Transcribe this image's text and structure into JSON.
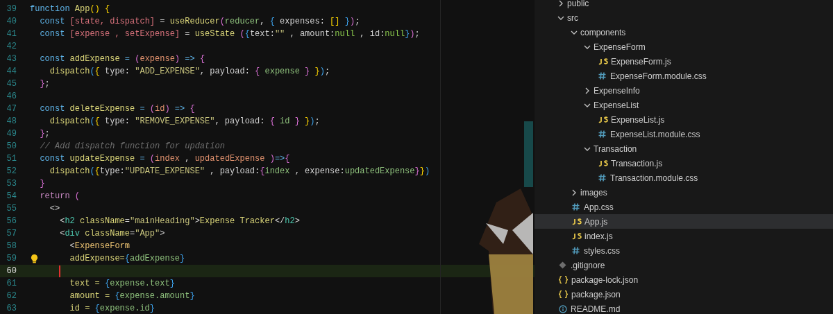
{
  "editor": {
    "lines": [
      {
        "number": "39",
        "current": false,
        "lightbulb": false,
        "tokens": [
          {
            "kind": "kw",
            "text": "function "
          },
          {
            "kind": "fn",
            "text": "App"
          },
          {
            "kind": "b1",
            "text": "() {"
          }
        ]
      },
      {
        "number": "40",
        "current": false,
        "lightbulb": false,
        "tokens": [
          {
            "kind": "kw",
            "text": "  const "
          },
          {
            "kind": "var",
            "text": "[state, dispatch]"
          },
          {
            "kind": "p",
            "text": " = "
          },
          {
            "kind": "fn",
            "text": "useReducer"
          },
          {
            "kind": "b2",
            "text": "("
          },
          {
            "kind": "ref",
            "text": "reducer"
          },
          {
            "kind": "p",
            "text": ", "
          },
          {
            "kind": "b3",
            "text": "{"
          },
          {
            "kind": "p",
            "text": " expenses: "
          },
          {
            "kind": "b1",
            "text": "[]"
          },
          {
            "kind": "b3",
            "text": " }"
          },
          {
            "kind": "b2",
            "text": ")"
          },
          {
            "kind": "p",
            "text": ";"
          }
        ]
      },
      {
        "number": "41",
        "current": false,
        "lightbulb": false,
        "tokens": [
          {
            "kind": "kw",
            "text": "  const "
          },
          {
            "kind": "var",
            "text": "[expense , setExpense]"
          },
          {
            "kind": "p",
            "text": " = "
          },
          {
            "kind": "fn",
            "text": "useState "
          },
          {
            "kind": "b2",
            "text": "("
          },
          {
            "kind": "b3",
            "text": "{"
          },
          {
            "kind": "p",
            "text": "text:"
          },
          {
            "kind": "str",
            "text": "\"\""
          },
          {
            "kind": "p",
            "text": " , amount:"
          },
          {
            "kind": "nul",
            "text": "null"
          },
          {
            "kind": "p",
            "text": " , id:"
          },
          {
            "kind": "nul",
            "text": "null"
          },
          {
            "kind": "b3",
            "text": "}"
          },
          {
            "kind": "b2",
            "text": ")"
          },
          {
            "kind": "p",
            "text": ";"
          }
        ]
      },
      {
        "number": "42",
        "current": false,
        "lightbulb": false
      },
      {
        "number": "43",
        "current": false,
        "lightbulb": false,
        "tokens": [
          {
            "kind": "kw",
            "text": "  const "
          },
          {
            "kind": "fn",
            "text": "addExpense"
          },
          {
            "kind": "kw",
            "text": " = "
          },
          {
            "kind": "b2",
            "text": "("
          },
          {
            "kind": "param",
            "text": "expense"
          },
          {
            "kind": "b2",
            "text": ")"
          },
          {
            "kind": "kw",
            "text": " => "
          },
          {
            "kind": "b2",
            "text": "{"
          }
        ]
      },
      {
        "number": "44",
        "current": false,
        "lightbulb": false,
        "tokens": [
          {
            "kind": "fn",
            "text": "    dispatch"
          },
          {
            "kind": "b3",
            "text": "("
          },
          {
            "kind": "b1",
            "text": "{"
          },
          {
            "kind": "p",
            "text": " type: "
          },
          {
            "kind": "str",
            "text": "\"ADD_EXPENSE\""
          },
          {
            "kind": "p",
            "text": ", payload: "
          },
          {
            "kind": "b2",
            "text": "{"
          },
          {
            "kind": "ref",
            "text": " expense "
          },
          {
            "kind": "b2",
            "text": "}"
          },
          {
            "kind": "b1",
            "text": " }"
          },
          {
            "kind": "b3",
            "text": ")"
          },
          {
            "kind": "p",
            "text": ";"
          }
        ]
      },
      {
        "number": "45",
        "current": false,
        "lightbulb": false,
        "tokens": [
          {
            "kind": "b2",
            "text": "  }"
          },
          {
            "kind": "p",
            "text": ";"
          }
        ]
      },
      {
        "number": "46",
        "current": false,
        "lightbulb": false
      },
      {
        "number": "47",
        "current": false,
        "lightbulb": false,
        "tokens": [
          {
            "kind": "kw",
            "text": "  const "
          },
          {
            "kind": "fn",
            "text": "deleteExpense"
          },
          {
            "kind": "kw",
            "text": " = "
          },
          {
            "kind": "b2",
            "text": "("
          },
          {
            "kind": "param",
            "text": "id"
          },
          {
            "kind": "b2",
            "text": ")"
          },
          {
            "kind": "kw",
            "text": " => "
          },
          {
            "kind": "b2",
            "text": "{"
          }
        ]
      },
      {
        "number": "48",
        "current": false,
        "lightbulb": false,
        "tokens": [
          {
            "kind": "fn",
            "text": "    dispatch"
          },
          {
            "kind": "b3",
            "text": "("
          },
          {
            "kind": "b1",
            "text": "{"
          },
          {
            "kind": "p",
            "text": " type: "
          },
          {
            "kind": "str",
            "text": "\"REMOVE_EXPENSE\""
          },
          {
            "kind": "p",
            "text": ", payload: "
          },
          {
            "kind": "b2",
            "text": "{"
          },
          {
            "kind": "ref",
            "text": " id "
          },
          {
            "kind": "b2",
            "text": "}"
          },
          {
            "kind": "b1",
            "text": " }"
          },
          {
            "kind": "b3",
            "text": ")"
          },
          {
            "kind": "p",
            "text": ";"
          }
        ]
      },
      {
        "number": "49",
        "current": false,
        "lightbulb": false,
        "tokens": [
          {
            "kind": "b2",
            "text": "  }"
          },
          {
            "kind": "p",
            "text": ";"
          }
        ]
      },
      {
        "number": "50",
        "current": false,
        "lightbulb": false,
        "tokens": [
          {
            "kind": "cmt",
            "text": "  // Add dispatch function for updation"
          }
        ]
      },
      {
        "number": "51",
        "current": false,
        "lightbulb": false,
        "tokens": [
          {
            "kind": "kw",
            "text": "  const "
          },
          {
            "kind": "fn",
            "text": "updateExpense"
          },
          {
            "kind": "kw",
            "text": " = "
          },
          {
            "kind": "b2",
            "text": "("
          },
          {
            "kind": "param",
            "text": "index"
          },
          {
            "kind": "p",
            "text": " , "
          },
          {
            "kind": "param",
            "text": "updatedExpense"
          },
          {
            "kind": "b2",
            "text": " )"
          },
          {
            "kind": "kw",
            "text": "=>"
          },
          {
            "kind": "b2",
            "text": "{"
          }
        ]
      },
      {
        "number": "52",
        "current": false,
        "lightbulb": false,
        "tokens": [
          {
            "kind": "fn",
            "text": "    dispatch"
          },
          {
            "kind": "b3",
            "text": "("
          },
          {
            "kind": "b1",
            "text": "{"
          },
          {
            "kind": "p",
            "text": "type:"
          },
          {
            "kind": "str",
            "text": "\"UPDATE_EXPENSE\""
          },
          {
            "kind": "p",
            "text": " , payload:"
          },
          {
            "kind": "b2",
            "text": "{"
          },
          {
            "kind": "ref",
            "text": "index"
          },
          {
            "kind": "p",
            "text": " , expense:"
          },
          {
            "kind": "ref",
            "text": "updatedExpense"
          },
          {
            "kind": "b2",
            "text": "}"
          },
          {
            "kind": "b1",
            "text": "}"
          },
          {
            "kind": "b3",
            "text": ")"
          }
        ]
      },
      {
        "number": "53",
        "current": false,
        "lightbulb": false,
        "tokens": [
          {
            "kind": "b2",
            "text": "  }"
          }
        ]
      },
      {
        "number": "54",
        "current": false,
        "lightbulb": false,
        "tokens": [
          {
            "kind": "ctl",
            "text": "  return "
          },
          {
            "kind": "b2",
            "text": "("
          }
        ]
      },
      {
        "number": "55",
        "current": false,
        "lightbulb": false,
        "tokens": [
          {
            "kind": "p",
            "text": "    <>"
          }
        ]
      },
      {
        "number": "56",
        "current": false,
        "lightbulb": false,
        "tokens": [
          {
            "kind": "p",
            "text": "      <"
          },
          {
            "kind": "tag",
            "text": "h2"
          },
          {
            "kind": "attr",
            "text": " className"
          },
          {
            "kind": "p",
            "text": "="
          },
          {
            "kind": "str",
            "text": "\"mainHeading\""
          },
          {
            "kind": "p",
            "text": ">"
          },
          {
            "kind": "attr",
            "text": "Expense Tracker"
          },
          {
            "kind": "p",
            "text": "</"
          },
          {
            "kind": "tag",
            "text": "h2"
          },
          {
            "kind": "p",
            "text": ">"
          }
        ]
      },
      {
        "number": "57",
        "current": false,
        "lightbulb": false,
        "tokens": [
          {
            "kind": "p",
            "text": "      <"
          },
          {
            "kind": "tag",
            "text": "div"
          },
          {
            "kind": "attr",
            "text": " className"
          },
          {
            "kind": "p",
            "text": "="
          },
          {
            "kind": "str",
            "text": "\"App\""
          },
          {
            "kind": "p",
            "text": ">"
          }
        ]
      },
      {
        "number": "58",
        "current": false,
        "lightbulb": false,
        "tokens": [
          {
            "kind": "p",
            "text": "        <"
          },
          {
            "kind": "comp",
            "text": "ExpenseForm"
          }
        ]
      },
      {
        "number": "59",
        "current": false,
        "lightbulb": true,
        "tokens": [
          {
            "kind": "attr",
            "text": "        addExpense="
          },
          {
            "kind": "b3",
            "text": "{"
          },
          {
            "kind": "ref",
            "text": "addExpense"
          },
          {
            "kind": "b3",
            "text": "}"
          }
        ]
      },
      {
        "number": "60",
        "current": true,
        "lightbulb": false
      },
      {
        "number": "61",
        "current": false,
        "lightbulb": false,
        "tokens": [
          {
            "kind": "attr",
            "text": "        text = "
          },
          {
            "kind": "b3",
            "text": "{"
          },
          {
            "kind": "ref",
            "text": "expense.text"
          },
          {
            "kind": "b3",
            "text": "}"
          }
        ]
      },
      {
        "number": "62",
        "current": false,
        "lightbulb": false,
        "tokens": [
          {
            "kind": "attr",
            "text": "        amount = "
          },
          {
            "kind": "b3",
            "text": "{"
          },
          {
            "kind": "ref",
            "text": "expense.amount"
          },
          {
            "kind": "b3",
            "text": "}"
          }
        ]
      },
      {
        "number": "63",
        "current": false,
        "lightbulb": false,
        "tokens": [
          {
            "kind": "attr",
            "text": "        id = "
          },
          {
            "kind": "b3",
            "text": "{"
          },
          {
            "kind": "ref",
            "text": "expense.id"
          },
          {
            "kind": "b3",
            "text": "}"
          }
        ]
      }
    ]
  },
  "explorer": {
    "items": [
      {
        "name": "public",
        "kind": "folder",
        "expanded": false,
        "selected": false
      },
      {
        "name": "src",
        "kind": "folder",
        "expanded": true,
        "selected": false,
        "children": [
          {
            "name": "components",
            "kind": "folder",
            "expanded": true,
            "selected": false,
            "children": [
              {
                "name": "ExpenseForm",
                "kind": "folder",
                "expanded": true,
                "selected": false,
                "children": [
                  {
                    "name": "ExpenseForm.js",
                    "kind": "js",
                    "selected": false
                  },
                  {
                    "name": "ExpenseForm.module.css",
                    "kind": "css",
                    "selected": false
                  }
                ]
              },
              {
                "name": "ExpenseInfo",
                "kind": "folder",
                "expanded": false,
                "selected": false
              },
              {
                "name": "ExpenseList",
                "kind": "folder",
                "expanded": true,
                "selected": false,
                "children": [
                  {
                    "name": "ExpenseList.js",
                    "kind": "js",
                    "selected": false
                  },
                  {
                    "name": "ExpenseList.module.css",
                    "kind": "css",
                    "selected": false
                  }
                ]
              },
              {
                "name": "Transaction",
                "kind": "folder",
                "expanded": true,
                "selected": false,
                "children": [
                  {
                    "name": "Transaction.js",
                    "kind": "js",
                    "selected": false
                  },
                  {
                    "name": "Transaction.module.css",
                    "kind": "css",
                    "selected": false
                  }
                ]
              }
            ]
          },
          {
            "name": "images",
            "kind": "folder",
            "expanded": false,
            "selected": false
          },
          {
            "name": "App.css",
            "kind": "css",
            "selected": false
          },
          {
            "name": "App.js",
            "kind": "js",
            "selected": true
          },
          {
            "name": "index.js",
            "kind": "js",
            "selected": false
          },
          {
            "name": "styles.css",
            "kind": "css",
            "selected": false
          }
        ]
      },
      {
        "name": ".gitignore",
        "kind": "git",
        "selected": false
      },
      {
        "name": "package-lock.json",
        "kind": "json",
        "selected": false
      },
      {
        "name": "package.json",
        "kind": "json",
        "selected": false
      },
      {
        "name": "README.md",
        "kind": "info",
        "selected": false
      }
    ]
  }
}
